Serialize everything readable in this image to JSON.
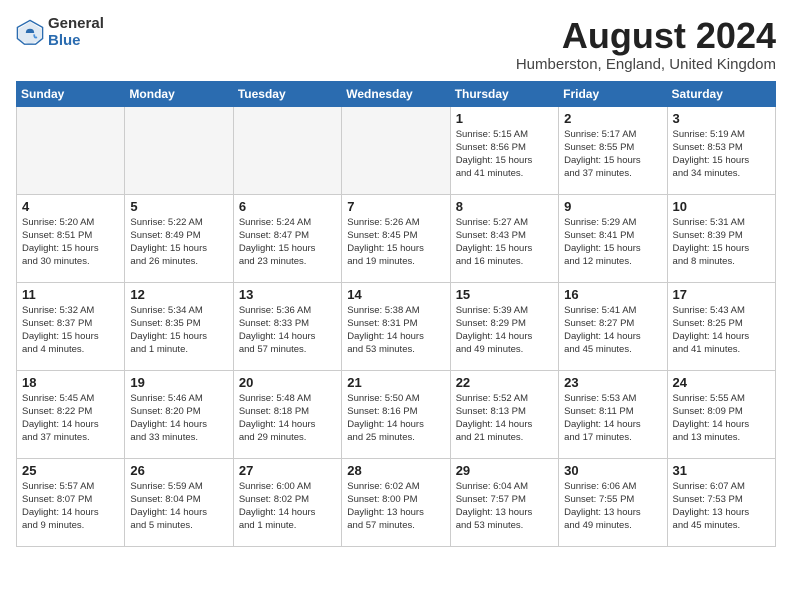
{
  "header": {
    "logo_general": "General",
    "logo_blue": "Blue",
    "month_year": "August 2024",
    "location": "Humberston, England, United Kingdom"
  },
  "weekdays": [
    "Sunday",
    "Monday",
    "Tuesday",
    "Wednesday",
    "Thursday",
    "Friday",
    "Saturday"
  ],
  "weeks": [
    [
      {
        "day": "",
        "info": ""
      },
      {
        "day": "",
        "info": ""
      },
      {
        "day": "",
        "info": ""
      },
      {
        "day": "",
        "info": ""
      },
      {
        "day": "1",
        "info": "Sunrise: 5:15 AM\nSunset: 8:56 PM\nDaylight: 15 hours\nand 41 minutes."
      },
      {
        "day": "2",
        "info": "Sunrise: 5:17 AM\nSunset: 8:55 PM\nDaylight: 15 hours\nand 37 minutes."
      },
      {
        "day": "3",
        "info": "Sunrise: 5:19 AM\nSunset: 8:53 PM\nDaylight: 15 hours\nand 34 minutes."
      }
    ],
    [
      {
        "day": "4",
        "info": "Sunrise: 5:20 AM\nSunset: 8:51 PM\nDaylight: 15 hours\nand 30 minutes."
      },
      {
        "day": "5",
        "info": "Sunrise: 5:22 AM\nSunset: 8:49 PM\nDaylight: 15 hours\nand 26 minutes."
      },
      {
        "day": "6",
        "info": "Sunrise: 5:24 AM\nSunset: 8:47 PM\nDaylight: 15 hours\nand 23 minutes."
      },
      {
        "day": "7",
        "info": "Sunrise: 5:26 AM\nSunset: 8:45 PM\nDaylight: 15 hours\nand 19 minutes."
      },
      {
        "day": "8",
        "info": "Sunrise: 5:27 AM\nSunset: 8:43 PM\nDaylight: 15 hours\nand 16 minutes."
      },
      {
        "day": "9",
        "info": "Sunrise: 5:29 AM\nSunset: 8:41 PM\nDaylight: 15 hours\nand 12 minutes."
      },
      {
        "day": "10",
        "info": "Sunrise: 5:31 AM\nSunset: 8:39 PM\nDaylight: 15 hours\nand 8 minutes."
      }
    ],
    [
      {
        "day": "11",
        "info": "Sunrise: 5:32 AM\nSunset: 8:37 PM\nDaylight: 15 hours\nand 4 minutes."
      },
      {
        "day": "12",
        "info": "Sunrise: 5:34 AM\nSunset: 8:35 PM\nDaylight: 15 hours\nand 1 minute."
      },
      {
        "day": "13",
        "info": "Sunrise: 5:36 AM\nSunset: 8:33 PM\nDaylight: 14 hours\nand 57 minutes."
      },
      {
        "day": "14",
        "info": "Sunrise: 5:38 AM\nSunset: 8:31 PM\nDaylight: 14 hours\nand 53 minutes."
      },
      {
        "day": "15",
        "info": "Sunrise: 5:39 AM\nSunset: 8:29 PM\nDaylight: 14 hours\nand 49 minutes."
      },
      {
        "day": "16",
        "info": "Sunrise: 5:41 AM\nSunset: 8:27 PM\nDaylight: 14 hours\nand 45 minutes."
      },
      {
        "day": "17",
        "info": "Sunrise: 5:43 AM\nSunset: 8:25 PM\nDaylight: 14 hours\nand 41 minutes."
      }
    ],
    [
      {
        "day": "18",
        "info": "Sunrise: 5:45 AM\nSunset: 8:22 PM\nDaylight: 14 hours\nand 37 minutes."
      },
      {
        "day": "19",
        "info": "Sunrise: 5:46 AM\nSunset: 8:20 PM\nDaylight: 14 hours\nand 33 minutes."
      },
      {
        "day": "20",
        "info": "Sunrise: 5:48 AM\nSunset: 8:18 PM\nDaylight: 14 hours\nand 29 minutes."
      },
      {
        "day": "21",
        "info": "Sunrise: 5:50 AM\nSunset: 8:16 PM\nDaylight: 14 hours\nand 25 minutes."
      },
      {
        "day": "22",
        "info": "Sunrise: 5:52 AM\nSunset: 8:13 PM\nDaylight: 14 hours\nand 21 minutes."
      },
      {
        "day": "23",
        "info": "Sunrise: 5:53 AM\nSunset: 8:11 PM\nDaylight: 14 hours\nand 17 minutes."
      },
      {
        "day": "24",
        "info": "Sunrise: 5:55 AM\nSunset: 8:09 PM\nDaylight: 14 hours\nand 13 minutes."
      }
    ],
    [
      {
        "day": "25",
        "info": "Sunrise: 5:57 AM\nSunset: 8:07 PM\nDaylight: 14 hours\nand 9 minutes."
      },
      {
        "day": "26",
        "info": "Sunrise: 5:59 AM\nSunset: 8:04 PM\nDaylight: 14 hours\nand 5 minutes."
      },
      {
        "day": "27",
        "info": "Sunrise: 6:00 AM\nSunset: 8:02 PM\nDaylight: 14 hours\nand 1 minute."
      },
      {
        "day": "28",
        "info": "Sunrise: 6:02 AM\nSunset: 8:00 PM\nDaylight: 13 hours\nand 57 minutes."
      },
      {
        "day": "29",
        "info": "Sunrise: 6:04 AM\nSunset: 7:57 PM\nDaylight: 13 hours\nand 53 minutes."
      },
      {
        "day": "30",
        "info": "Sunrise: 6:06 AM\nSunset: 7:55 PM\nDaylight: 13 hours\nand 49 minutes."
      },
      {
        "day": "31",
        "info": "Sunrise: 6:07 AM\nSunset: 7:53 PM\nDaylight: 13 hours\nand 45 minutes."
      }
    ]
  ]
}
